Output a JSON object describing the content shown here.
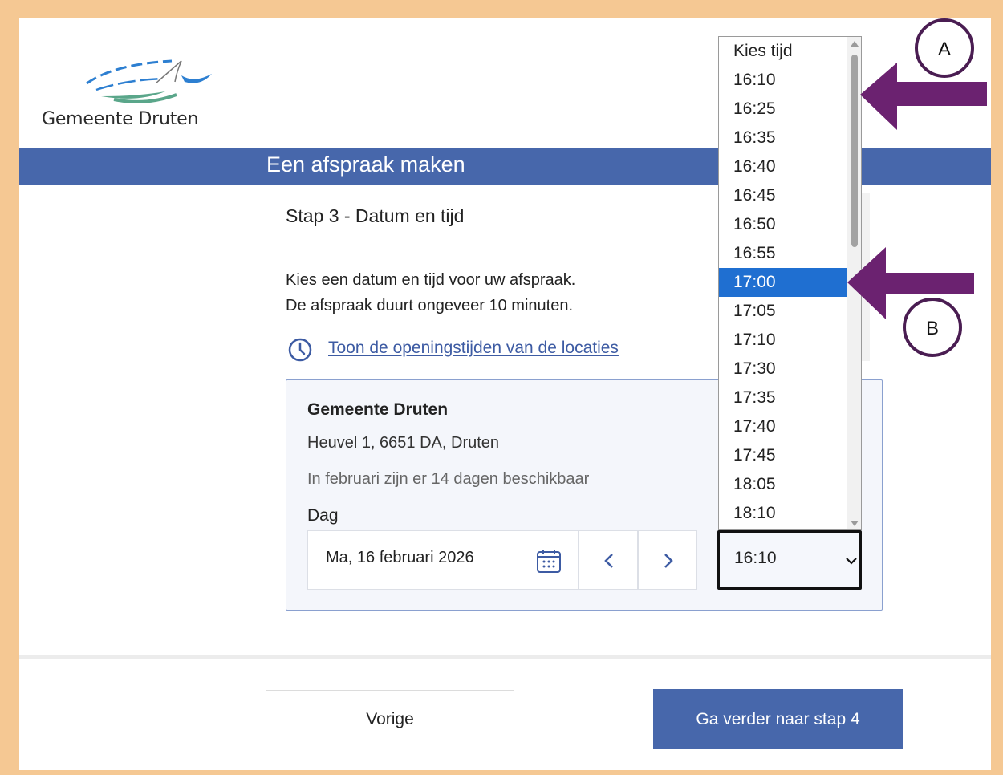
{
  "logo": {
    "name": "Gemeente Druten"
  },
  "header": {
    "title": "Een afspraak maken"
  },
  "step": {
    "title": "Stap 3 - Datum en tijd"
  },
  "intro": {
    "line1": "Kies een datum en tijd voor uw afspraak.",
    "line2": "De afspraak duurt ongeveer 10 minuten."
  },
  "opening_hours_link": "Toon de openingstijden van de locaties",
  "location": {
    "name": "Gemeente Druten",
    "address": "Heuvel 1, 6651 DA, Druten",
    "availability": "In februari zijn er 14 dagen beschikbaar",
    "day_label": "Dag",
    "date_value": "Ma, 16 februari 2026"
  },
  "time_select": {
    "value": "16:10",
    "options": [
      "Kies tijd",
      "16:10",
      "16:25",
      "16:35",
      "16:40",
      "16:45",
      "16:50",
      "16:55",
      "17:00",
      "17:05",
      "17:10",
      "17:30",
      "17:35",
      "17:40",
      "17:45",
      "18:05",
      "18:10"
    ],
    "highlighted": "17:00"
  },
  "footer": {
    "prev_label": "Vorige",
    "next_label": "Ga verder naar stap 4"
  },
  "annotations": {
    "callout_a": "A",
    "callout_b": "B",
    "arrow_color": "#6b2270",
    "frame_color": "#f5c893"
  },
  "colors": {
    "brand_blue": "#4767ab",
    "link_blue": "#3d5ba3",
    "selected_option": "#1f6fd1"
  }
}
